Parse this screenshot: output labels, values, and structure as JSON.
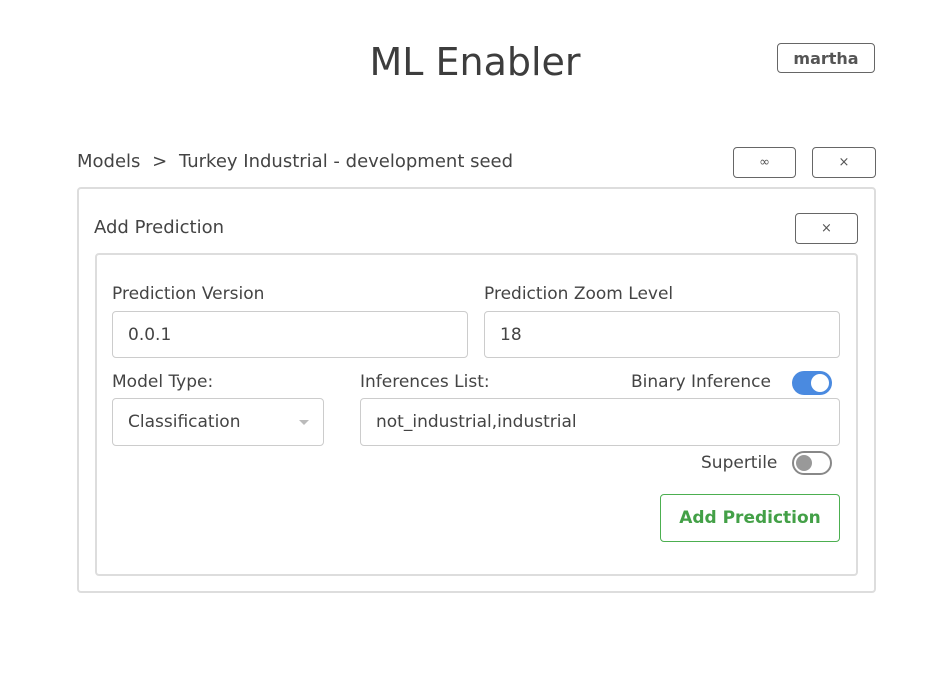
{
  "header": {
    "title": "ML Enabler",
    "user": "martha"
  },
  "breadcrumb": {
    "root": "Models",
    "separator": ">",
    "current": "Turkey Industrial - development seed"
  },
  "toolbar": {
    "link_icon": "link-icon",
    "close_icon": "close-icon"
  },
  "panel": {
    "title": "Add Prediction",
    "form": {
      "version_label": "Prediction Version",
      "version_value": "0.0.1",
      "zoom_label": "Prediction Zoom Level",
      "zoom_value": "18",
      "model_type_label": "Model Type:",
      "model_type_value": "Classification",
      "inferences_label": "Inferences List:",
      "inferences_value": "not_industrial,industrial",
      "binary_label": "Binary Inference",
      "binary_on": true,
      "supertile_label": "Supertile",
      "supertile_on": false,
      "submit_label": "Add Prediction"
    }
  },
  "colors": {
    "accent": "#4a8ae0",
    "submit": "#43a047"
  }
}
